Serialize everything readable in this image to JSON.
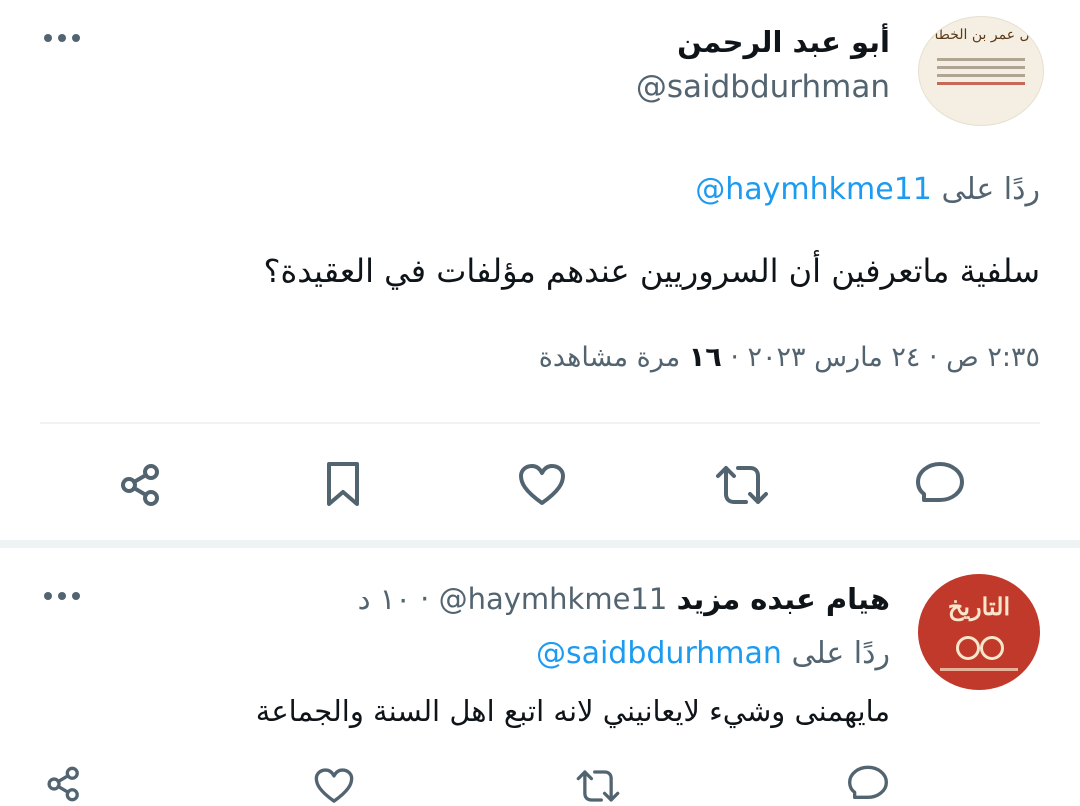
{
  "main_tweet": {
    "author_name": "أبو عبد الرحمن",
    "handle": "@saidbdurhman",
    "avatar_text": "قال عمر بن الخطاب",
    "reply_to_prefix": "ردًا على",
    "reply_to_handle": "@haymhkme11",
    "text": "سلفية ماتعرفين أن السروريين عندهم مؤلفات في العقيدة؟",
    "timestamp": "٢:٣٥ ص · ٢٤ مارس ٢٠٢٣ ·",
    "views_count": "١٦",
    "views_label": "مرة مشاهدة"
  },
  "reply_tweet": {
    "author_name": "هيام عبده مزيد",
    "handle": "@haymhkme11",
    "time": "· ١٠ د",
    "avatar_text": "التاريخ",
    "reply_to_prefix": "ردًا على",
    "reply_to_handle": "@saidbdurhman",
    "text": "مايهمنى وشيء لايعانيني لانه اتبع اهل السنة والجماعة"
  },
  "colors": {
    "accent": "#1d9bf0",
    "muted": "#536471",
    "divider": "#eff3f4",
    "reply_avatar": "#c0392b"
  }
}
